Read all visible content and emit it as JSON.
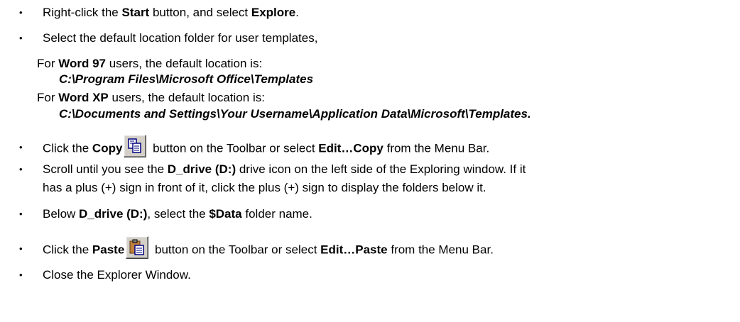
{
  "steps": [
    {
      "pre": "Right-click the ",
      "b1": "Start",
      "mid": " button, and select ",
      "b2": "Explore",
      "post": "."
    },
    {
      "text": "Select the default location folder for user templates,"
    },
    {
      "pre": "Click the ",
      "b1": "Copy",
      "mid": " button on the Toolbar or select ",
      "b2": "Edit…Copy",
      "post": " from the Menu Bar.",
      "icon": "copy-icon"
    },
    {
      "line1_pre": "Scroll until you see the ",
      "line1_b": "D_drive (D:)",
      "line1_post": " drive icon on the left side of the Exploring window. If it",
      "line2": "has a plus (+) sign in front of it, click the plus (+) sign to display the folders below it."
    },
    {
      "pre": "Below ",
      "b1": "D_drive (D:)",
      "mid": ", select the ",
      "b2": "$Data",
      "post": " folder name."
    },
    {
      "pre": "Click the ",
      "b1": "Paste",
      "mid": " button on the Toolbar or select ",
      "b2": "Edit…Paste",
      "post": " from the Menu Bar.",
      "icon": "paste-icon"
    },
    {
      "text": "Close the Explorer Window."
    }
  ],
  "word97": {
    "pre": "For ",
    "b": "Word 97",
    "post": " users, the default location is:",
    "path": "C:\\Program Files\\Microsoft Office\\Templates"
  },
  "wordxp": {
    "pre": "For ",
    "b": "Word XP",
    "post": " users, the default location is:",
    "path": "C:\\Documents and Settings\\Your Username\\Application Data\\Microsoft\\Templates."
  },
  "bullet_char": "•"
}
